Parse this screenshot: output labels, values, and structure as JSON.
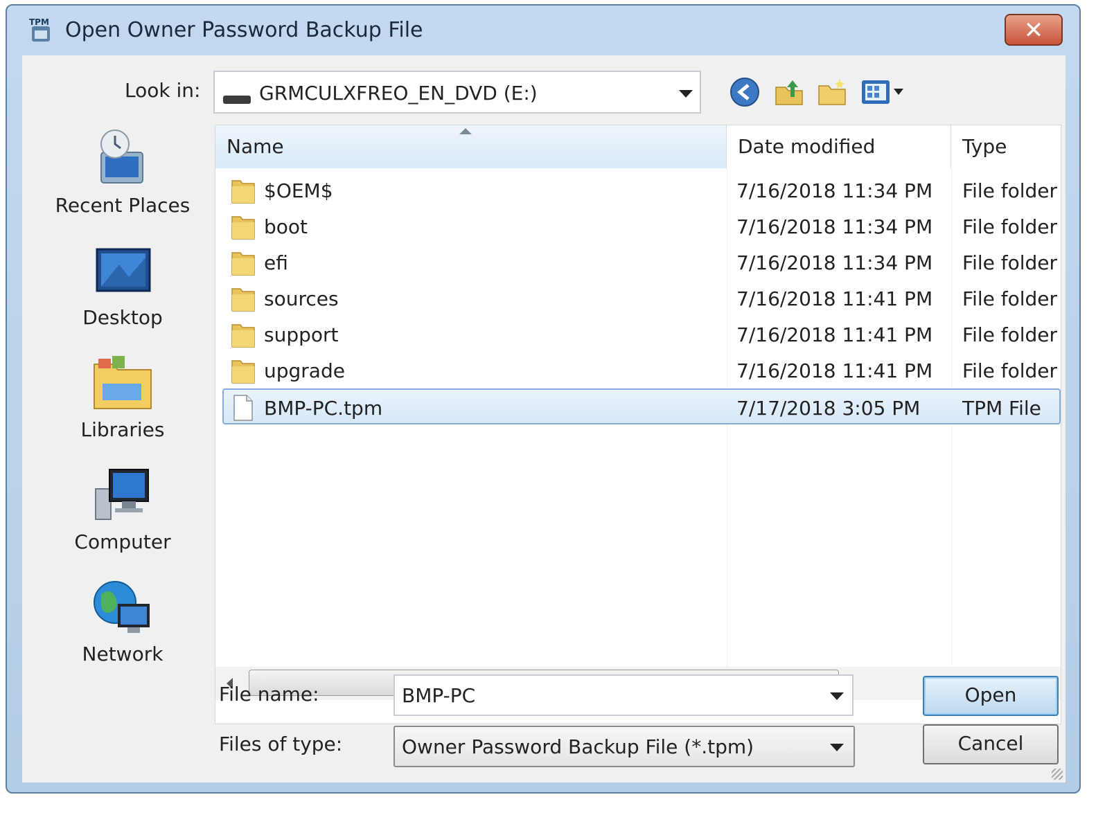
{
  "window": {
    "title": "Open Owner Password Backup File",
    "app_icon_text": "TPM",
    "close_label": "✕"
  },
  "lookin": {
    "label": "Look in:",
    "value": "GRMCULXFREO_EN_DVD (E:)"
  },
  "toolbar": {
    "back_icon": "back-icon",
    "up_icon": "up-folder-icon",
    "new_folder_icon": "new-folder-icon",
    "views_icon": "views-menu-icon"
  },
  "places": [
    {
      "label": "Recent Places",
      "icon": "recent-places-icon"
    },
    {
      "label": "Desktop",
      "icon": "desktop-icon"
    },
    {
      "label": "Libraries",
      "icon": "libraries-icon"
    },
    {
      "label": "Computer",
      "icon": "computer-icon"
    },
    {
      "label": "Network",
      "icon": "network-icon"
    }
  ],
  "columns": {
    "name": "Name",
    "date": "Date modified",
    "type": "Type"
  },
  "files": [
    {
      "name": "$OEM$",
      "date": "7/16/2018 11:34 PM",
      "type": "File folder",
      "kind": "folder"
    },
    {
      "name": "boot",
      "date": "7/16/2018 11:34 PM",
      "type": "File folder",
      "kind": "folder"
    },
    {
      "name": "efi",
      "date": "7/16/2018 11:34 PM",
      "type": "File folder",
      "kind": "folder"
    },
    {
      "name": "sources",
      "date": "7/16/2018 11:41 PM",
      "type": "File folder",
      "kind": "folder"
    },
    {
      "name": "support",
      "date": "7/16/2018 11:41 PM",
      "type": "File folder",
      "kind": "folder"
    },
    {
      "name": "upgrade",
      "date": "7/16/2018 11:41 PM",
      "type": "File folder",
      "kind": "folder"
    },
    {
      "name": "BMP-PC.tpm",
      "date": "7/17/2018 3:05 PM",
      "type": "TPM File",
      "kind": "file",
      "selected": true
    }
  ],
  "form": {
    "filename_label": "File name:",
    "filename_value": "BMP-PC",
    "filetype_label": "Files of type:",
    "filetype_value": "Owner Password Backup File (*.tpm)"
  },
  "buttons": {
    "open": "Open",
    "cancel": "Cancel"
  }
}
